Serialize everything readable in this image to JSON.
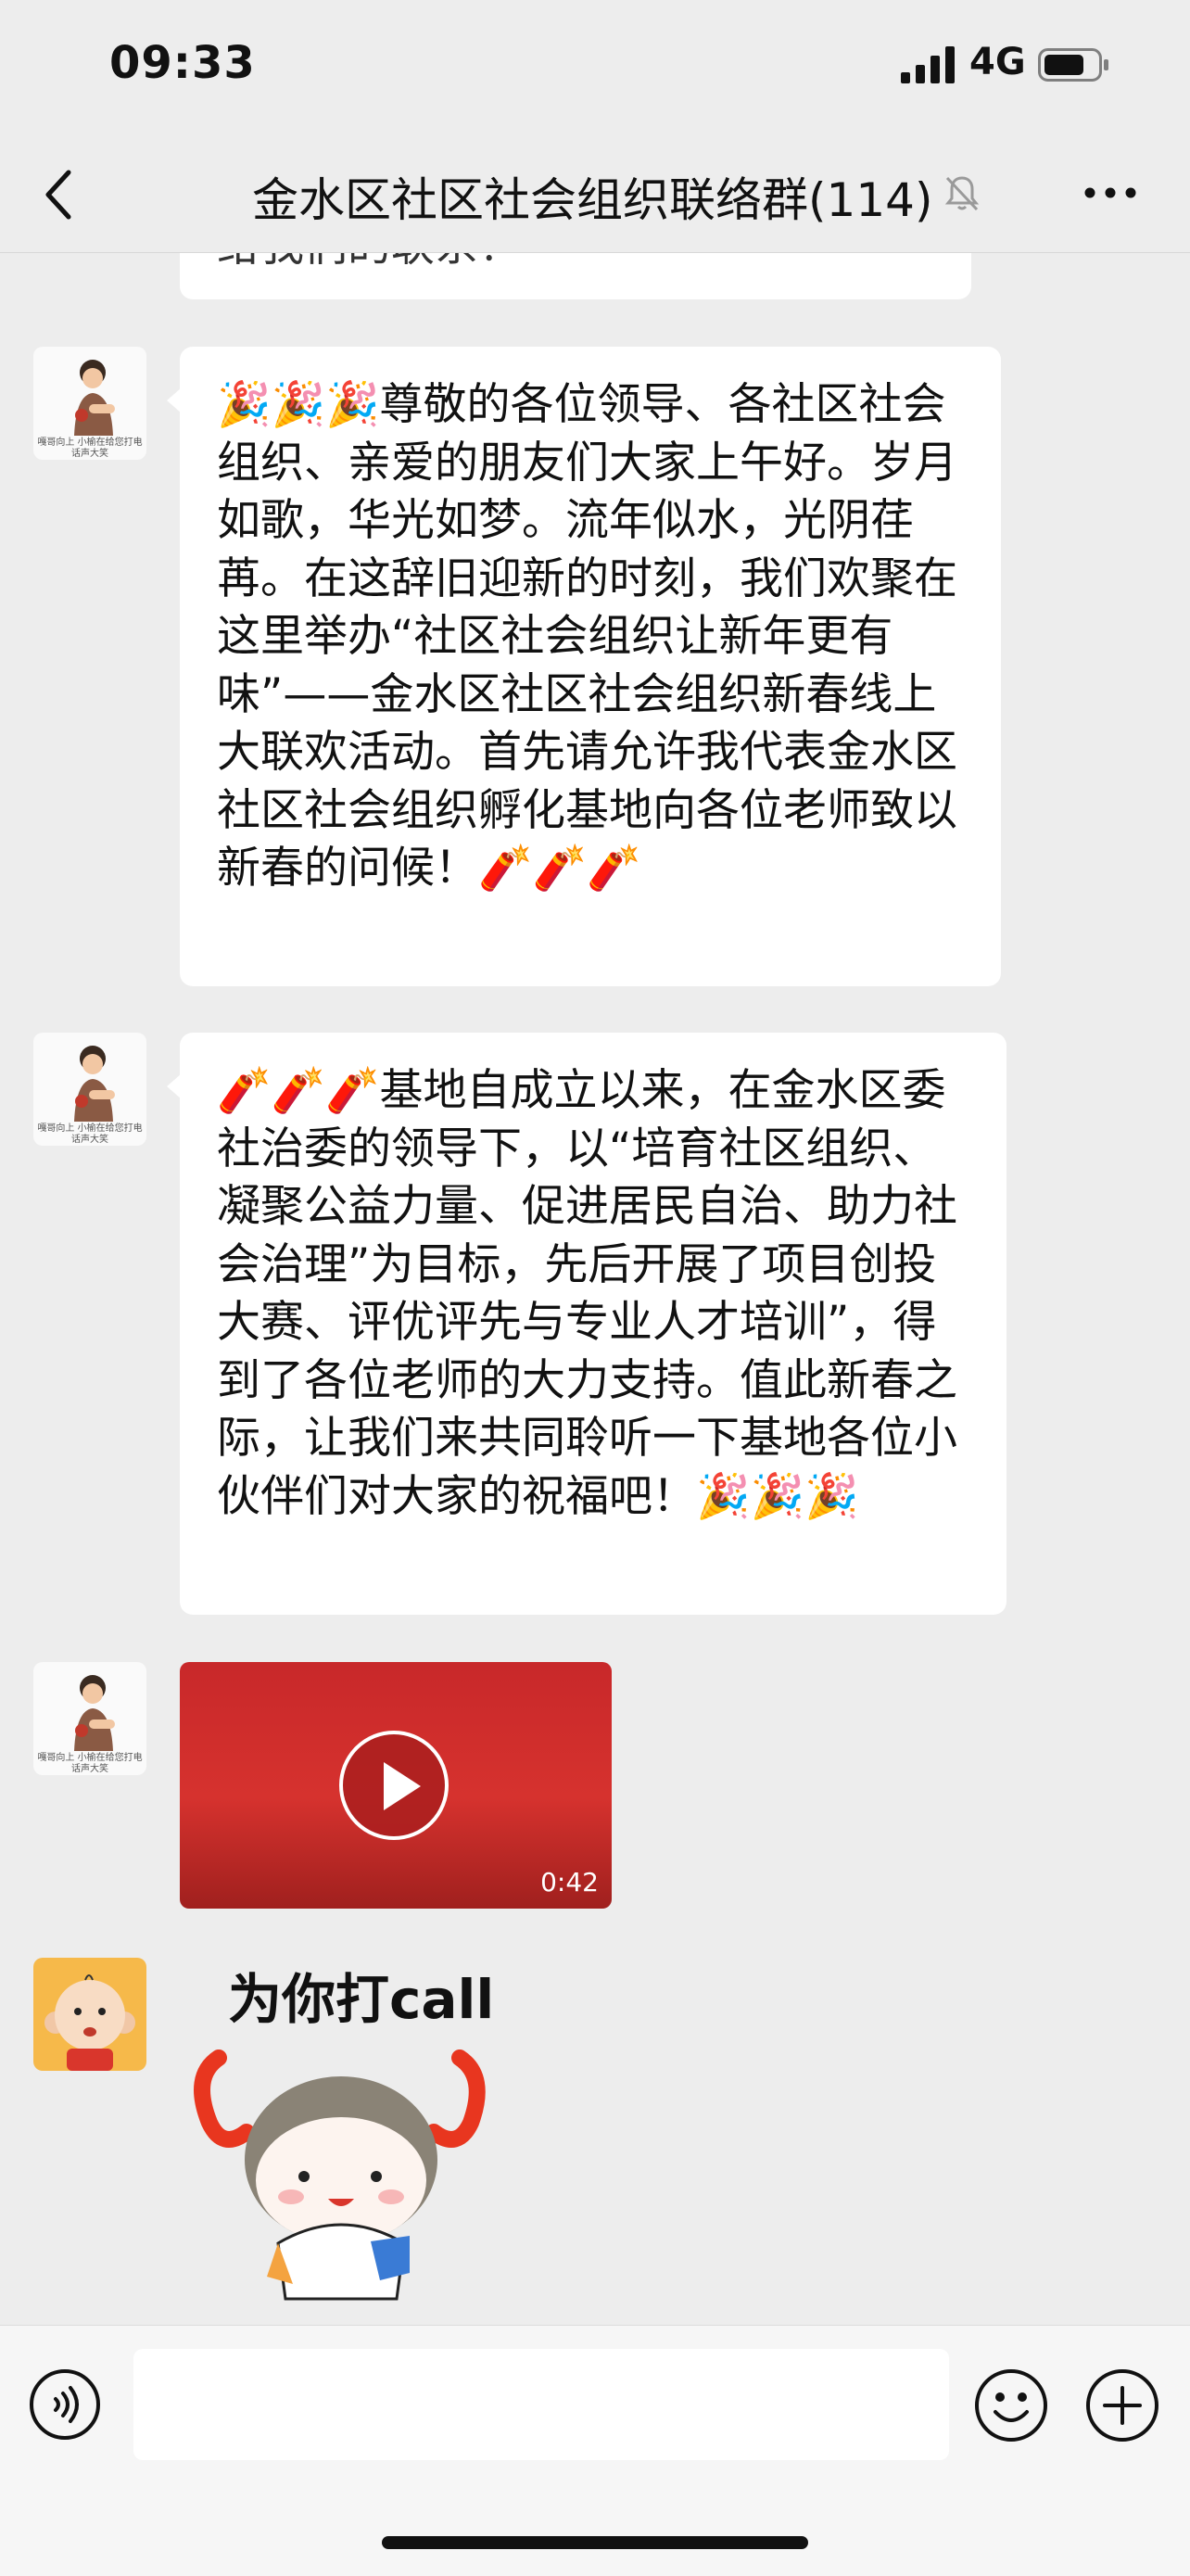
{
  "status_bar": {
    "time": "09:33",
    "network": "4G"
  },
  "nav": {
    "title": "金水区社区社会组织联络群(114)"
  },
  "messages": [
    {
      "type": "text-partial",
      "text": "给我们的联系！"
    },
    {
      "type": "text",
      "text": "🎉🎉🎉尊敬的各位领导、各社区社会组织、亲爱的朋友们大家上午好。岁月如歌，华光如梦。流年似水，光阴荏苒。在这辞旧迎新的时刻，我们欢聚在这里举办“社区社会组织让新年更有味”——金水区社区社会组织新春线上大联欢活动。首先请允许我代表金水区社区社会组织孵化基地向各位老师致以新春的问候！🧨🧨🧨"
    },
    {
      "type": "text",
      "text": "🧨🧨🧨基地自成立以来，在金水区委社治委的领导下，以“培育社区组织、凝聚公益力量、促进居民自治、助力社会治理”为目标，先后开展了项目创投大赛、评优评先与专业人才培训”，得到了各位老师的大力支持。值此新春之际，让我们来共同聆听一下基地各位小伙伴们对大家的祝福吧！🎉🎉🎉"
    },
    {
      "type": "video",
      "duration": "0:42"
    },
    {
      "type": "sticker",
      "caption": "为你打call"
    }
  ],
  "avatar_caption": "嘎哥向上 小榆在给您打电话声大笑",
  "icons": {
    "back": "chevron-left-icon",
    "mute": "bell-slash-icon",
    "more": "ellipsis-icon",
    "voice": "voice-icon",
    "emoji": "smile-icon",
    "plus": "plus-icon",
    "play": "play-icon"
  }
}
